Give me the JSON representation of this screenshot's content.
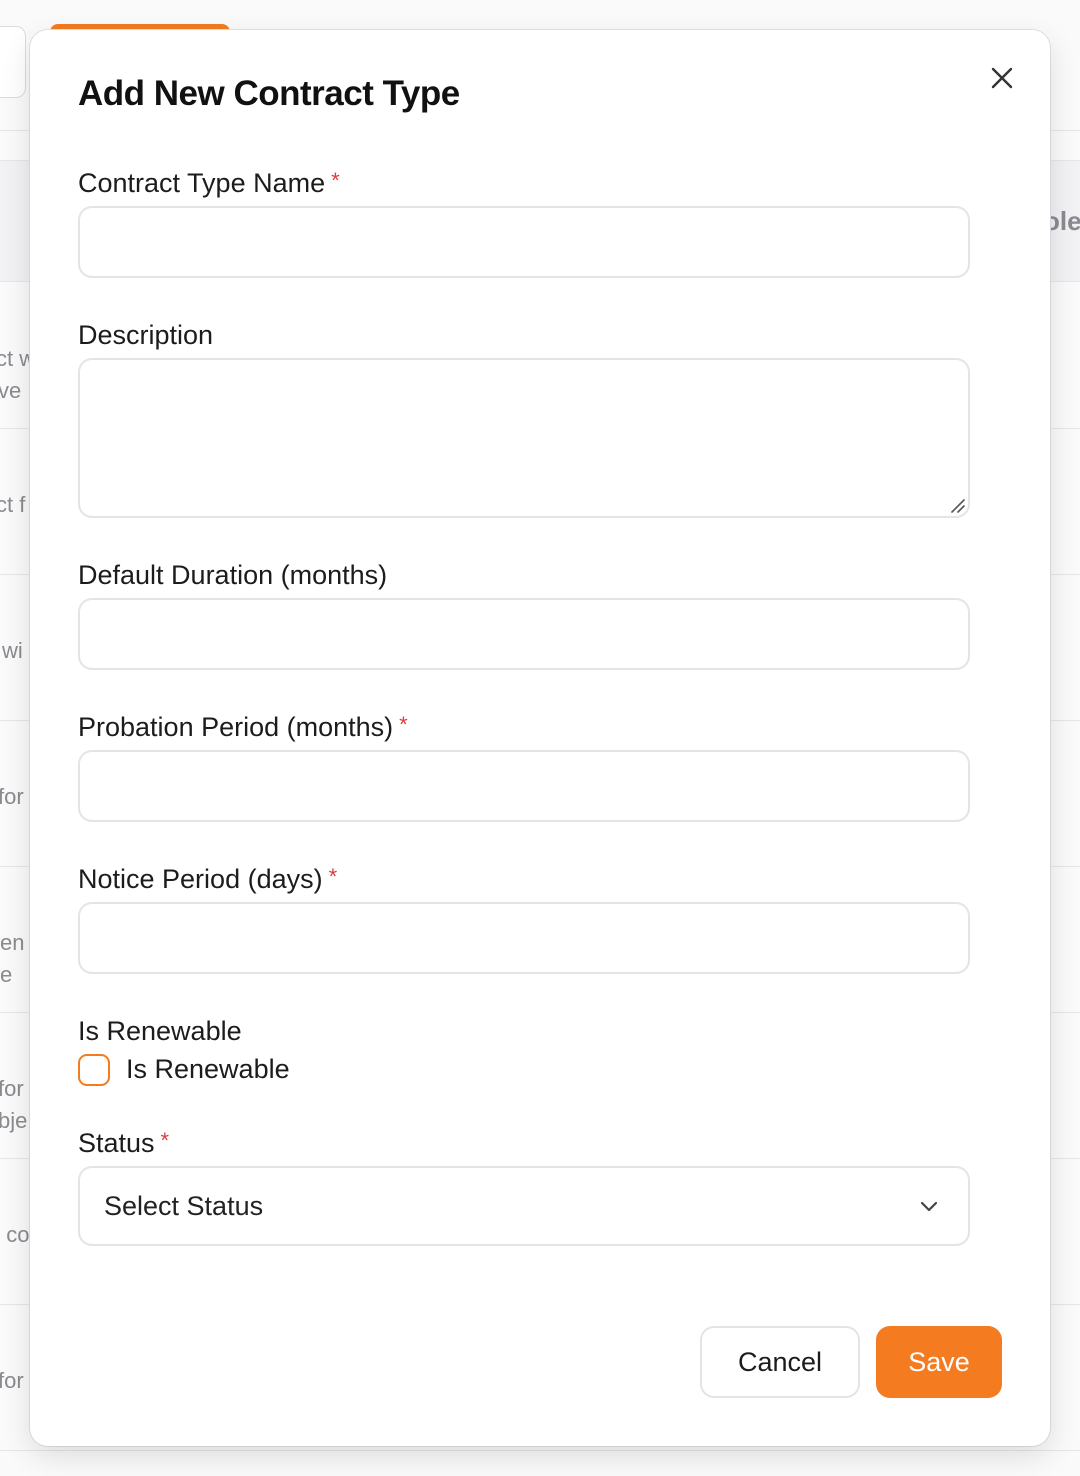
{
  "background": {
    "left_fragments": [
      "ct w",
      "ve",
      "ct f",
      "wi",
      "for",
      "en",
      "e",
      "for",
      "bje",
      "t co",
      "for"
    ],
    "right_fragment": "ole"
  },
  "modal": {
    "title": "Add New Contract Type",
    "close_icon": "close-icon",
    "fields": {
      "name": {
        "label": "Contract Type Name",
        "required": "*",
        "value": "",
        "placeholder": ""
      },
      "description": {
        "label": "Description",
        "value": "",
        "placeholder": ""
      },
      "default_duration": {
        "label": "Default Duration (months)",
        "value": "",
        "placeholder": ""
      },
      "probation_period": {
        "label": "Probation Period (months)",
        "required": "*",
        "value": "",
        "placeholder": ""
      },
      "notice_period": {
        "label": "Notice Period (days)",
        "required": "*",
        "value": "",
        "placeholder": ""
      },
      "is_renewable": {
        "label": "Is Renewable",
        "checkbox_label": "Is Renewable",
        "checked": false
      },
      "status": {
        "label": "Status",
        "required": "*",
        "selected": "Select Status"
      }
    },
    "buttons": {
      "cancel": "Cancel",
      "save": "Save"
    }
  },
  "colors": {
    "accent": "#f47b20",
    "required": "#e23b3b",
    "border": "#e4e4e7"
  }
}
